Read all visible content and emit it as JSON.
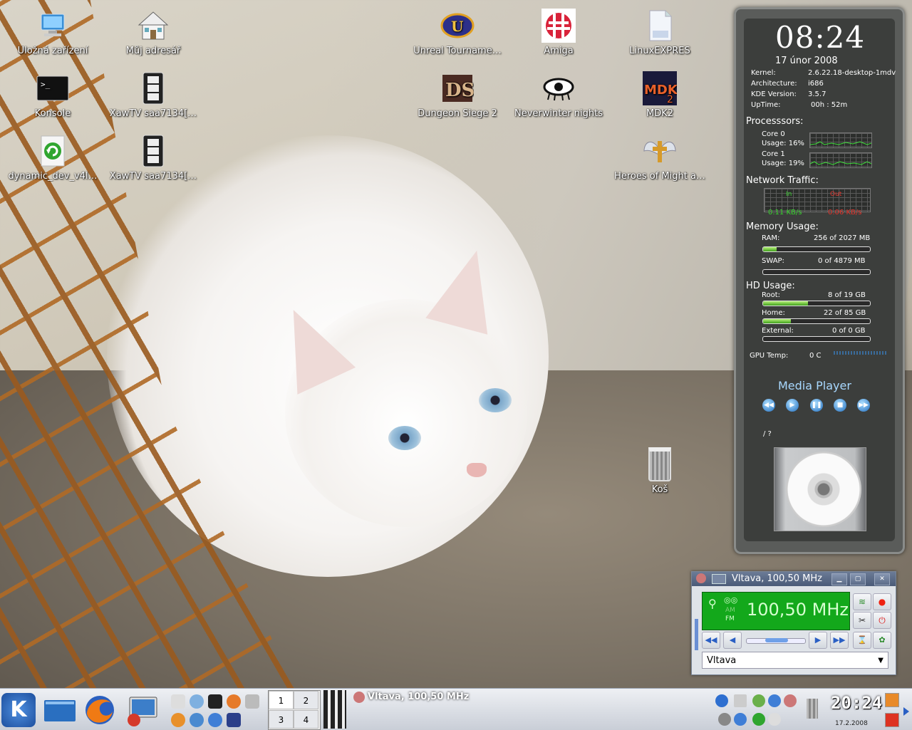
{
  "desktop_icons": [
    {
      "id": "ulozna",
      "label": "Úložná zařízení",
      "icon": "storage-devices-icon"
    },
    {
      "id": "adresar",
      "label": "Můj adresář",
      "icon": "home-folder-icon"
    },
    {
      "id": "unreal",
      "label": "Unreal Tourname…",
      "icon": "unreal-tournament-icon"
    },
    {
      "id": "amiga",
      "label": "Amiga",
      "icon": "amiga-boing-ball-icon"
    },
    {
      "id": "linuxexpres",
      "label": "LinuxEXPRES",
      "icon": "document-icon"
    },
    {
      "id": "konsole",
      "label": "Konsole",
      "icon": "terminal-icon"
    },
    {
      "id": "xawtv1",
      "label": "XawTV saa7134[…",
      "icon": "film-strip-icon"
    },
    {
      "id": "dungeon",
      "label": "Dungeon Siege 2",
      "icon": "dungeon-siege-icon"
    },
    {
      "id": "neverwinter",
      "label": "Neverwinter nights",
      "icon": "neverwinter-eye-icon"
    },
    {
      "id": "mdk2",
      "label": "MDK2",
      "icon": "mdk2-icon"
    },
    {
      "id": "dynamic",
      "label": "dynamic_dev_v4l…",
      "icon": "script-refresh-icon"
    },
    {
      "id": "xawtv2",
      "label": "XawTV saa7134[…",
      "icon": "film-strip-icon"
    },
    {
      "id": "heroes",
      "label": "Heroes of Might a…",
      "icon": "heroes-emblem-icon"
    },
    {
      "id": "kos",
      "label": "Koš",
      "icon": "trash-icon"
    }
  ],
  "sysmon": {
    "time": "08:24",
    "date": "17 únor 2008",
    "kernel_label": "Kernel:",
    "kernel": "2.6.22.18-desktop-1mdv",
    "arch_label": "Architecture:",
    "arch": "i686",
    "kde_label": "KDE Version:",
    "kde": "3.5.7",
    "uptime_label": "UpTime:",
    "uptime": "00h : 52m",
    "processors_title": "Processsors:",
    "core0_label": "Core 0",
    "core0_usage": "Usage:  16%",
    "core1_label": "Core 1",
    "core1_usage": "Usage:  19%",
    "network_title": "Network Traffic:",
    "net_in_label": "In",
    "net_out_label": "Out",
    "net_in": "0.11 KB/s",
    "net_out": "0.06 KB/s",
    "memory_title": "Memory Usage:",
    "ram_label": "RAM:",
    "ram": "256 of 2027 MB",
    "ram_fraction": 0.126,
    "swap_label": "SWAP:",
    "swap": "0 of 4879 MB",
    "swap_fraction": 0.0,
    "hd_title": "HD Usage:",
    "root_label": "Root:",
    "root": "8 of 19 GB",
    "root_fraction": 0.42,
    "home_label": "Home:",
    "home": "22 of 85 GB",
    "home_fraction": 0.26,
    "external_label": "External:",
    "external": "0 of 0 GB",
    "external_fraction": 0.0,
    "gpu_label": "GPU Temp:",
    "gpu": "0 C",
    "media_title": "Media Player",
    "media_track": "/  ?",
    "colors": {
      "accent": "#a8d8ff",
      "in": "#38d12d",
      "out": "#e0342c"
    }
  },
  "radio": {
    "title": "Vltava, 100,50 MHz",
    "am": "AM",
    "fm": "FM",
    "frequency": "100,50 MHz",
    "station": "Vltava",
    "volume": 0.5
  },
  "taskbar": {
    "pager": [
      "1",
      "2",
      "3",
      "4"
    ],
    "task": "Vltava, 100,50 MHz",
    "clock": "20:24",
    "date": "17.2.2008"
  }
}
